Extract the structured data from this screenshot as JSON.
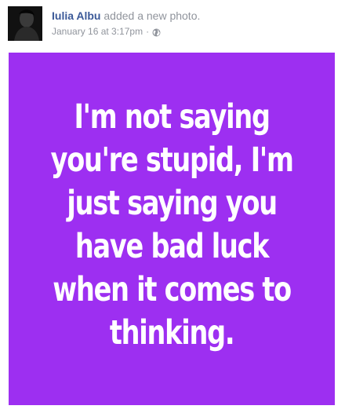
{
  "post": {
    "author": "Iulia Albu",
    "action": "added a new photo.",
    "timestamp": "January 16 at 3:17pm",
    "separator": "·",
    "privacy_icon": "globe-icon",
    "avatar_icon": "profile-photo"
  },
  "photo": {
    "background_color": "#9d2ff1",
    "text_color": "#ffffff",
    "lines": [
      "I'm not saying",
      "you're stupid, I'm",
      "just saying you",
      "have bad luck",
      "when it comes to",
      "thinking."
    ]
  }
}
